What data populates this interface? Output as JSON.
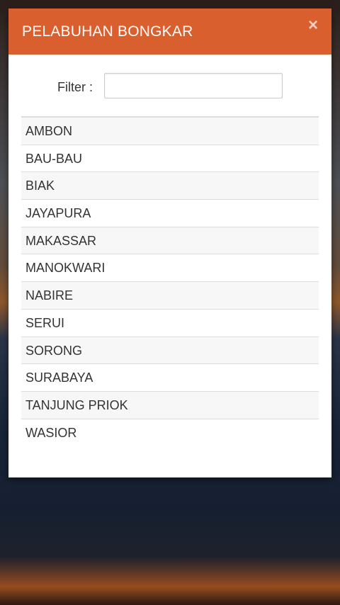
{
  "dialog": {
    "title": "PELABUHAN BONGKAR",
    "close_symbol": "×",
    "header_color": "#d95f2e"
  },
  "filter": {
    "label": "Filter :",
    "value": "",
    "placeholder": ""
  },
  "ports": [
    "AMBON",
    "BAU-BAU",
    "BIAK",
    "JAYAPURA",
    "MAKASSAR",
    "MANOKWARI",
    "NABIRE",
    "SERUI",
    "SORONG",
    "SURABAYA",
    "TANJUNG PRIOK",
    "WASIOR"
  ]
}
